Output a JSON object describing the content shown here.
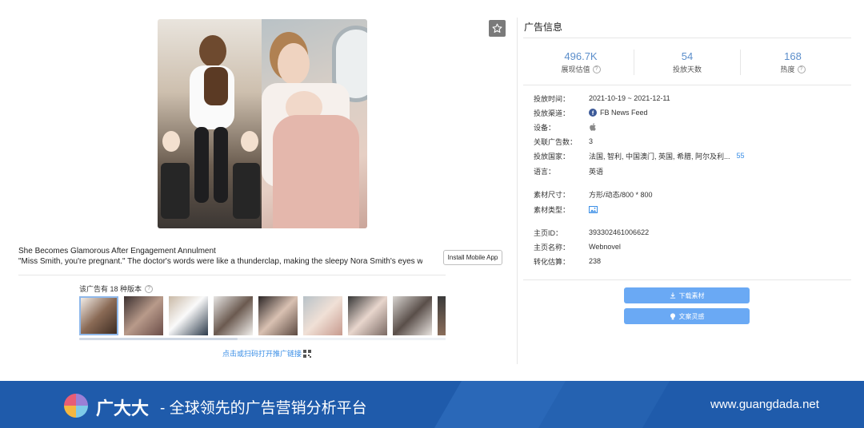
{
  "ad": {
    "title": "She Becomes Glamorous After Engagement Annulment",
    "body": "\"Miss Smith, you're pregnant.\" The doctor's words were like a thunderclap, making the sleepy Nora Smith's eyes wid...",
    "install_label": "Install Mobile App",
    "versions_label": "该广告有 18 种版本",
    "open_link_label": "点击或扫码打开推广链接"
  },
  "panel": {
    "title": "广告信息",
    "stats": [
      {
        "value": "496.7K",
        "label": "展现估值",
        "has_help": true
      },
      {
        "value": "54",
        "label": "投放天数",
        "has_help": false
      },
      {
        "value": "168",
        "label": "热度",
        "has_help": true
      }
    ],
    "rows": {
      "period_label": "投放时间：",
      "period_value": "2021-10-19 ~ 2021-12-11",
      "channel_label": "投放渠道：",
      "channel_value": "FB News Feed",
      "device_label": "设备：",
      "related_label": "关联广告数：",
      "related_value": "3",
      "country_label": "投放国家：",
      "country_value": "法国, 智利, 中国澳门, 英国, 希腊, 阿尔及利...",
      "country_count": "55",
      "language_label": "语言：",
      "language_value": "英语",
      "size_label": "素材尺寸：",
      "size_value": "方形/动态/800 * 800",
      "type_label": "素材类型：",
      "page_id_label": "主页ID：",
      "page_id_value": "393302461006622",
      "page_name_label": "主页名称：",
      "page_name_value": "Webnovel",
      "conversion_label": "转化估算：",
      "conversion_value": "238"
    },
    "download_label": "下载素材",
    "inspire_label": "文案灵感"
  },
  "footer": {
    "brand": "广大大",
    "slogan": "- 全球领先的广告营销分析平台",
    "site": "www.guangdada.net"
  },
  "colors": {
    "accent": "#6aa9f4",
    "link": "#3a8ee6",
    "stat": "#5b8ecb",
    "footer": "#1f5bab"
  }
}
